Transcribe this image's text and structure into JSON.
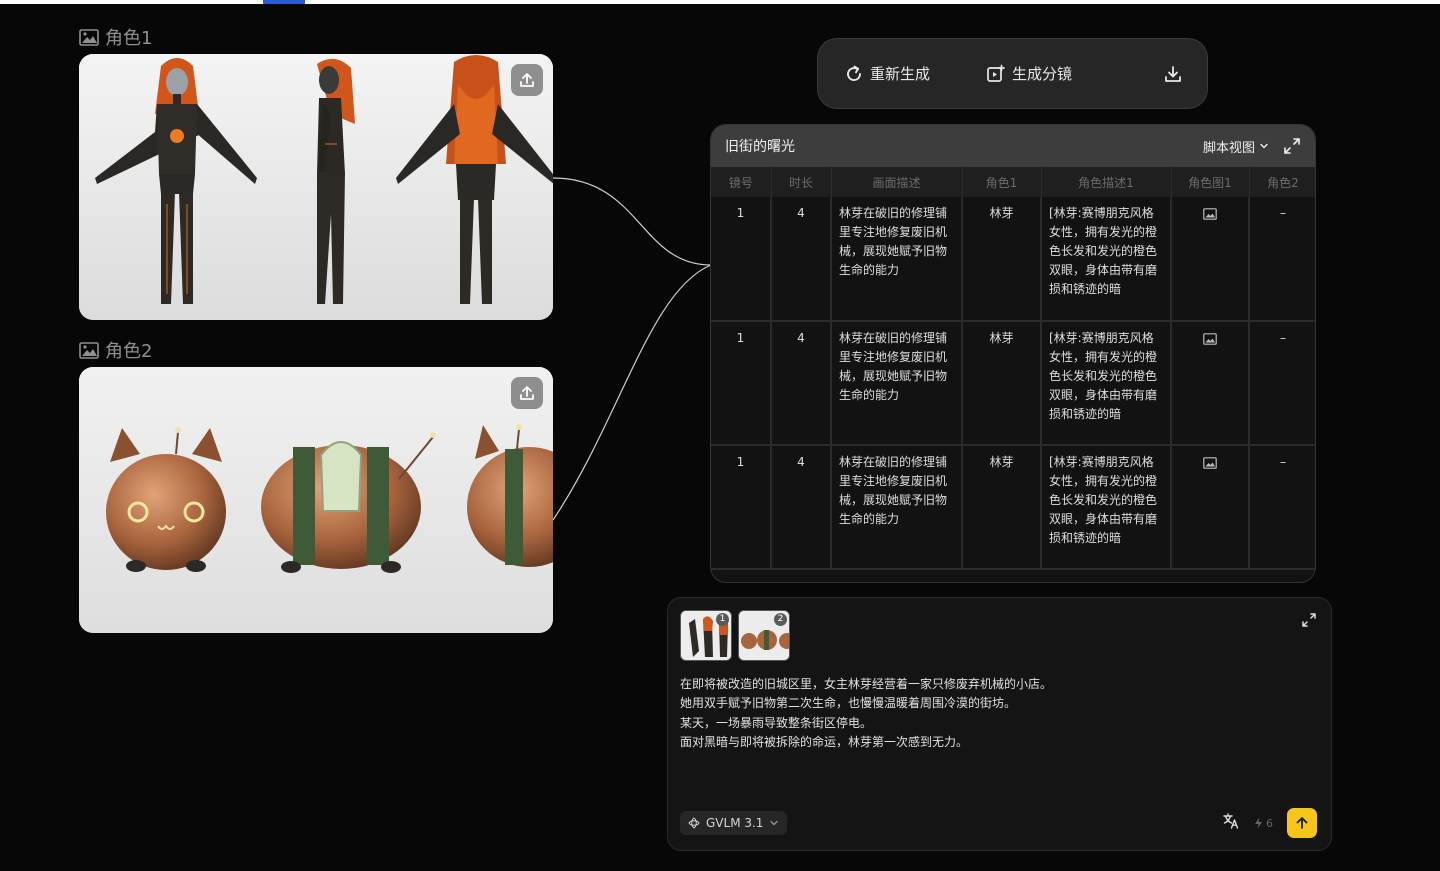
{
  "references": [
    {
      "label": "角色1",
      "icon": "image-icon",
      "action_icon": "upload-icon"
    },
    {
      "label": "角色2",
      "icon": "image-icon",
      "action_icon": "upload-icon"
    }
  ],
  "toolbar": {
    "regenerate_label": "重新生成",
    "storyboard_label": "生成分镜",
    "download_icon": "download-icon"
  },
  "script_panel": {
    "title": "旧街的曙光",
    "view_label": "脚本视图",
    "columns": [
      "镜号",
      "时长",
      "画面描述",
      "角色1",
      "角色描述1",
      "角色图1",
      "角色2"
    ],
    "rows": [
      {
        "shot": "1",
        "duration": "4",
        "scene": "林芽在破旧的修理铺里专注地修复废旧机械，展现她赋予旧物生命的能力",
        "role1": "林芽",
        "role1_desc": "[林芽:赛博朋克风格女性，拥有发光的橙色长发和发光的橙色双眼，身体由带有磨损和锈迹的暗",
        "role1_img": "image-icon",
        "role2": "–"
      },
      {
        "shot": "1",
        "duration": "4",
        "scene": "林芽在破旧的修理铺里专注地修复废旧机械，展现她赋予旧物生命的能力",
        "role1": "林芽",
        "role1_desc": "[林芽:赛博朋克风格女性，拥有发光的橙色长发和发光的橙色双眼，身体由带有磨损和锈迹的暗",
        "role1_img": "image-icon",
        "role2": "–"
      },
      {
        "shot": "1",
        "duration": "4",
        "scene": "林芽在破旧的修理铺里专注地修复废旧机械，展现她赋予旧物生命的能力",
        "role1": "林芽",
        "role1_desc": "[林芽:赛博朋克风格女性，拥有发光的橙色长发和发光的橙色双眼，身体由带有磨损和锈迹的暗",
        "role1_img": "image-icon",
        "role2": "–"
      }
    ]
  },
  "prompt": {
    "attachments": [
      {
        "badge": "1"
      },
      {
        "badge": "2"
      }
    ],
    "lines": [
      "在即将被改造的旧城区里，女主林芽经营着一家只修废弃机械的小店。",
      "她用双手赋予旧物第二次生命，也慢慢温暖着周围冷漠的街坊。",
      "某天，一场暴雨导致整条街区停电。",
      "面对黑暗与即将被拆除的命运，林芽第一次感到无力。"
    ],
    "model": "GVLM 3.1",
    "credits": "6"
  },
  "colors": {
    "background": "#070707",
    "accent_send": "#f5c518",
    "panel_header": "#3d3d3d"
  }
}
